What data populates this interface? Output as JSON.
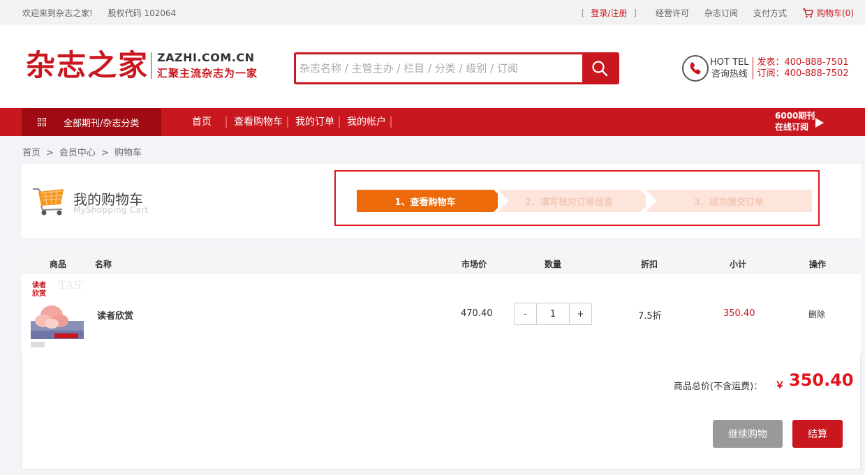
{
  "topbar": {
    "welcome": "欢迎来到杂志之家!",
    "stock": "股权代码 102064",
    "login": "登录/注册",
    "license": "经营许可",
    "subscribe": "杂志订阅",
    "payment": "支付方式",
    "cart": "购物车(0)"
  },
  "header": {
    "logo_cn": "杂志之家",
    "logo_en": "ZAZHI.COM.CN",
    "slogan": "汇聚主流杂志为一家",
    "search_placeholder": "杂志名称 / 主管主办 / 栏目 / 分类 / 级别 / 订阅",
    "hotline_label_1": "HOT TEL",
    "hotline_label_2": "咨询热线",
    "hotline_1_label": "发表：",
    "hotline_1": "400-888-7501",
    "hotline_2_label": "订阅：",
    "hotline_2": "400-888-7502"
  },
  "nav": {
    "categories": "全部期刊/杂志分类",
    "links": [
      "首页",
      "查看购物车",
      "我的订单",
      "我的帐户"
    ],
    "promo_line1": "6000期刊",
    "promo_line2": "在线订阅"
  },
  "breadcrumb": [
    "首页",
    "会员中心",
    "购物车"
  ],
  "cart_title": {
    "title": "我的购物车",
    "subtitle": "MyShopping Cart"
  },
  "steps": [
    "1、查看购物车",
    "2、填写核对订单信息",
    "3、成功提交订单"
  ],
  "table": {
    "headers": {
      "product": "商品",
      "name": "名称",
      "price": "市场价",
      "qty": "数量",
      "discount": "折扣",
      "subtotal": "小计",
      "action": "操作"
    },
    "rows": [
      {
        "name": "读者欣赏",
        "price": "470.40",
        "qty_minus": "-",
        "qty": "1",
        "qty_plus": "+",
        "discount": "7.5折",
        "subtotal": "350.40",
        "action": "删除",
        "cover_title": "读者欣赏",
        "cover_badge": "TASTE"
      }
    ]
  },
  "summary": {
    "label": "商品总价(不含运费)：",
    "currency": "￥",
    "total": "350.40",
    "continue": "继续购物",
    "checkout": "结算"
  },
  "colors": {
    "brand": "#c8171e",
    "step_active": "#ec6a09",
    "step_inactive": "#fde5dc"
  }
}
